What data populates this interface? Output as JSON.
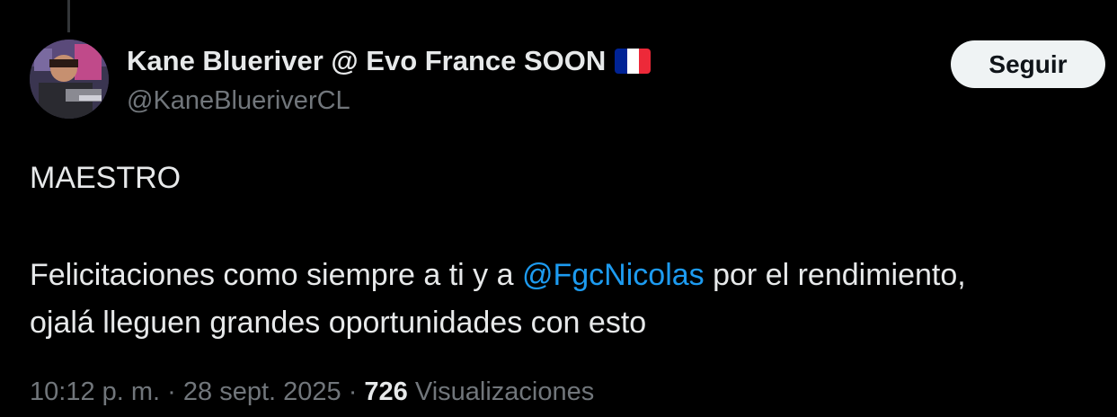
{
  "user": {
    "display_name": "Kane Blueriver @ Evo France SOON",
    "handle": "@KaneBlueriverCL",
    "flag_icon": "france-flag-icon"
  },
  "follow_button": {
    "label": "Seguir"
  },
  "tweet": {
    "line1": "MAESTRO",
    "line2_before": "Felicitaciones como siempre a ti y a ",
    "mention": "@FgcNicolas",
    "line2_after": " por el rendimiento,",
    "line3": "ojalá lleguen grandes oportunidades con esto"
  },
  "meta": {
    "time": "10:12 p. m.",
    "separator": " · ",
    "date": "28 sept. 2025",
    "views_count": "726",
    "views_label": "Visualizaciones"
  },
  "colors": {
    "background": "#000000",
    "text": "#e7e9ea",
    "secondary": "#71767b",
    "mention": "#1d9bf0",
    "button_bg": "#eff3f4",
    "flag": [
      "#002395",
      "#ffffff",
      "#ed2939"
    ]
  }
}
